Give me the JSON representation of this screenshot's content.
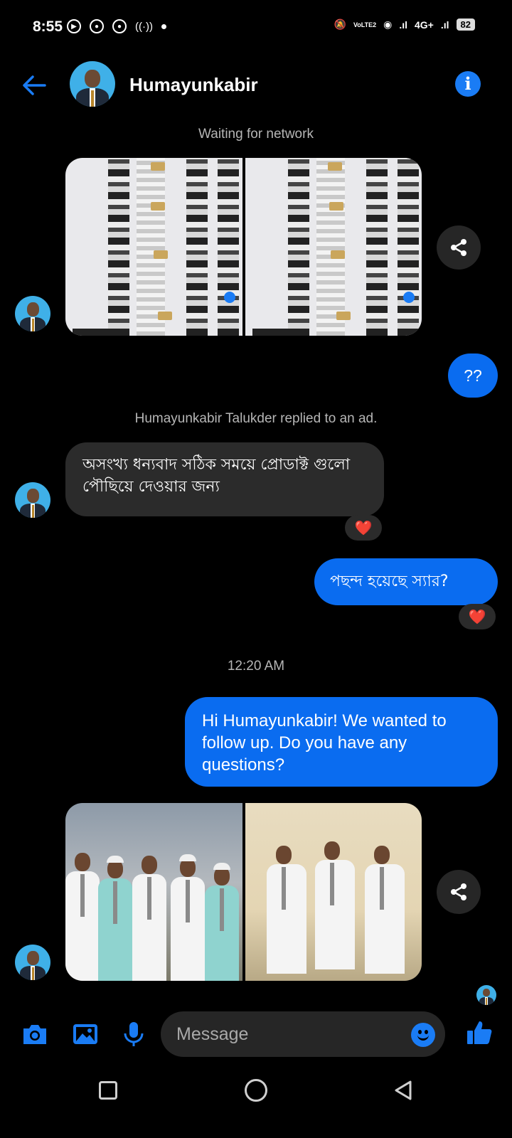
{
  "status_bar": {
    "time": "8:55",
    "network": "4G+",
    "volte": "VoLTE2",
    "battery": "82"
  },
  "header": {
    "name": "Humayunkabir",
    "back_icon": "arrow-left-icon",
    "info_icon": "info-icon"
  },
  "conversation": {
    "network_status": "Waiting for network",
    "outgoing_1": "??",
    "ad_reply_notice": "Humayunkabir Talukder replied to an ad.",
    "incoming_1": "অসংখ্য ধন্যবাদ সঠিক সময়ে প্রোডাক্ট গুলো পৌছিয়ে দেওয়ার জন্য",
    "incoming_1_reaction": "❤️",
    "outgoing_2": "পছন্দ হয়েছে স্যার?",
    "outgoing_2_reaction": "❤️",
    "timestamp": "12:20 AM",
    "outgoing_3": "Hi Humayunkabir! We wanted to follow up. Do you have any questions?"
  },
  "composer": {
    "placeholder": "Message",
    "icons": [
      "camera-icon",
      "gallery-icon",
      "microphone-icon",
      "emoji-icon",
      "thumbs-up-icon"
    ]
  },
  "colors": {
    "accent": "#0a6cf0",
    "bubble_them": "#2b2b2b",
    "background": "#000000"
  }
}
